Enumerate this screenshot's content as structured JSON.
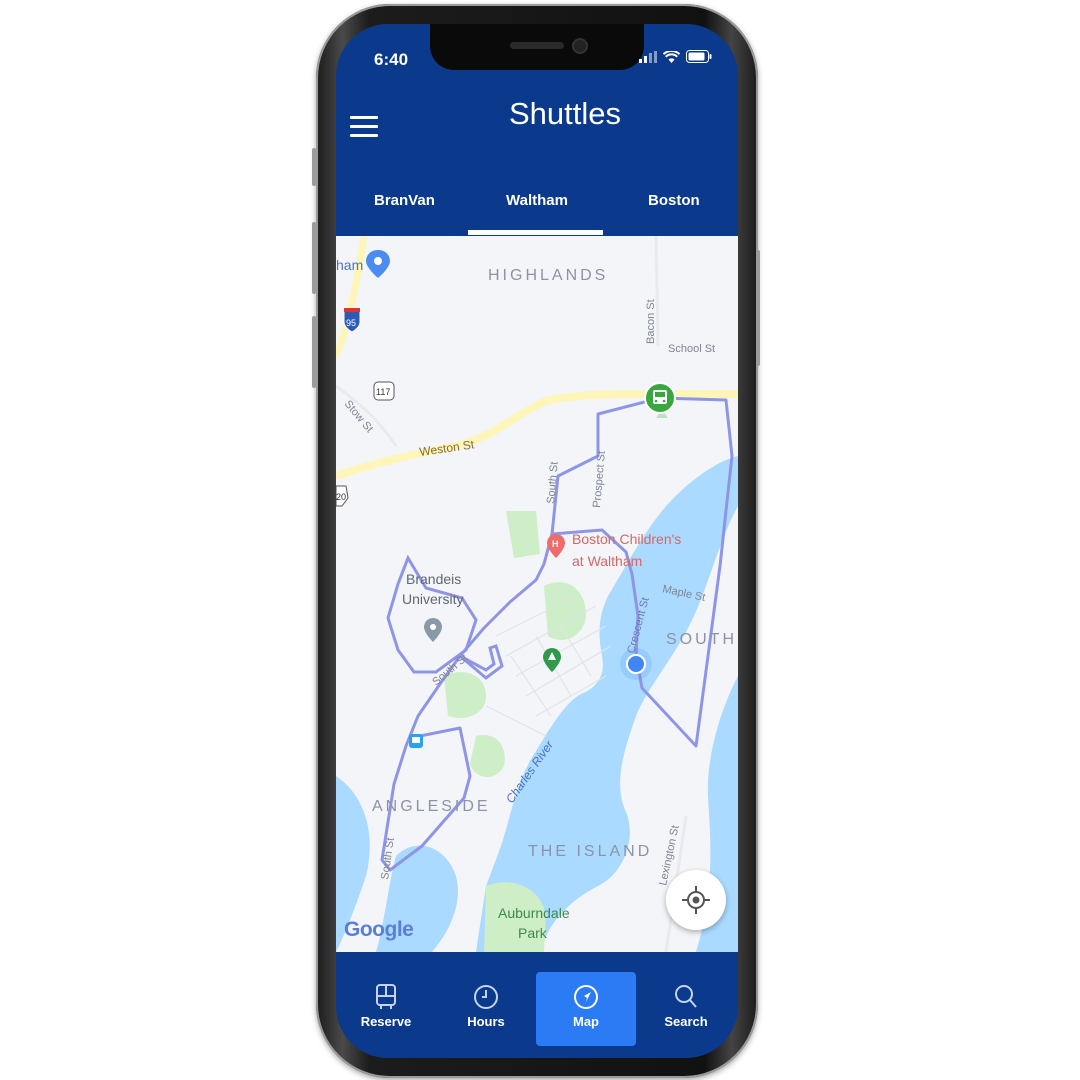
{
  "status_bar": {
    "time": "6:40"
  },
  "header": {
    "title": "Shuttles"
  },
  "tabs": [
    {
      "label": "BranVan",
      "active": false
    },
    {
      "label": "Waltham",
      "active": true
    },
    {
      "label": "Boston",
      "active": false
    }
  ],
  "map": {
    "labels": {
      "highlands": "HIGHLANDS",
      "south": "SOUTH",
      "angleside": "ANGLESIDE",
      "the_island": "THE ISLAND",
      "weston_st": "Weston St",
      "stow_st": "Stow St",
      "bacon_st": "Bacon St",
      "school_st": "School St",
      "south_st_1": "South St",
      "south_st_2": "South St",
      "south_st_3": "South St",
      "prospect_st": "Prospect St",
      "maple_st": "Maple St",
      "crescent_st": "Crescent St",
      "charles_river": "Charles River",
      "lexington_st": "Lexington St",
      "brandeis_line1": "Brandeis",
      "brandeis_line2": "University",
      "hospital_line1": "Boston Children's",
      "hospital_line2": "at Waltham",
      "park_line1": "Auburndale",
      "park_line2": "Park",
      "ham": "ham",
      "route_95": "95",
      "route_117": "117",
      "route_20": "20"
    },
    "attribution": "Google",
    "colors": {
      "route": "#8f95e6",
      "water": "#aadaff",
      "park": "#cdeec6",
      "road": "#fdf6b8",
      "vehicle": "#3aa640",
      "user_location": "#4285f4"
    }
  },
  "bottom_nav": [
    {
      "label": "Reserve",
      "icon": "bus-icon",
      "active": false
    },
    {
      "label": "Hours",
      "icon": "clock-icon",
      "active": false
    },
    {
      "label": "Map",
      "icon": "navigation-arrow-icon",
      "active": true
    },
    {
      "label": "Search",
      "icon": "search-icon",
      "active": false
    }
  ]
}
